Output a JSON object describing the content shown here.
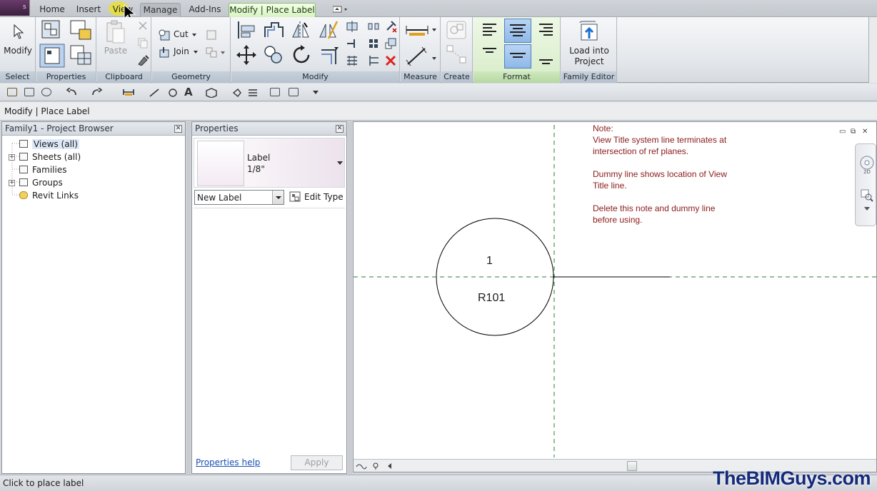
{
  "app": {
    "menu_letter": "s"
  },
  "tabs": {
    "home": "Home",
    "insert": "Insert",
    "view": "View",
    "manage": "Manage",
    "addins": "Add-Ins",
    "active": "Modify | Place Label"
  },
  "ribbon": {
    "select": {
      "label": "Select",
      "modify_button": "Modify"
    },
    "properties": {
      "label": "Properties"
    },
    "clipboard": {
      "label": "Clipboard",
      "paste_button": "Paste"
    },
    "geometry": {
      "label": "Geometry",
      "cut_button": "Cut",
      "join_button": "Join"
    },
    "modify": {
      "label": "Modify"
    },
    "measure": {
      "label": "Measure"
    },
    "create": {
      "label": "Create"
    },
    "format": {
      "label": "Format"
    },
    "family_editor": {
      "label": "Family Editor",
      "load_button_line1": "Load into",
      "load_button_line2": "Project"
    }
  },
  "options_bar": {
    "context": "Modify | Place Label"
  },
  "project_browser": {
    "title": "Family1 - Project Browser",
    "items": [
      {
        "label": "Views (all)",
        "expanded": false
      },
      {
        "label": "Sheets (all)",
        "expandable": true
      },
      {
        "label": "Families",
        "expandable": false
      },
      {
        "label": "Groups",
        "expandable": true
      },
      {
        "label": "Revit Links",
        "expandable": false
      }
    ]
  },
  "properties": {
    "title": "Properties",
    "type_name": "Label",
    "type_size": "1/8\"",
    "filter_value": "New Label",
    "edit_type": "Edit Type",
    "help_link": "Properties help",
    "apply_button": "Apply"
  },
  "drawing": {
    "note_title": "Note:",
    "note_lines": [
      "View Title system line terminates at",
      "intersection of ref planes.",
      "",
      "Dummy line shows location of View",
      "Title line.",
      "",
      "Delete this note and dummy line",
      "before using."
    ],
    "circle_top": "1",
    "circle_bottom": "R101",
    "note_color": "#8b1a1a",
    "ref_plane_color": "#2e7d32"
  },
  "status_bar": {
    "message": "Click to place label"
  },
  "watermark": "TheBIMGuys.com"
}
